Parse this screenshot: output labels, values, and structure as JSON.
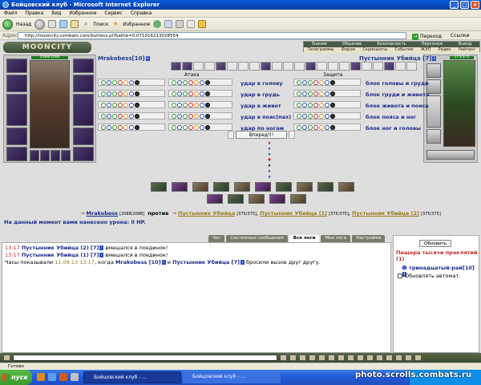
{
  "window": {
    "title": "Бойцовский клуб - Microsoft Internet Explorer"
  },
  "menu": [
    "Файл",
    "Правка",
    "Вид",
    "Избранное",
    "Сервис",
    "Справка"
  ],
  "toolbar": {
    "back": "Назад",
    "search": "Поиск",
    "favorites": "Избранное"
  },
  "address": {
    "label": "Адрес:",
    "url": "http://mooncity.combats.com/buttons.pl?battle=0.071016213028554",
    "go": "Переход",
    "links": "Ссылки"
  },
  "site": {
    "logo": "MOONCITY",
    "nav_row1": [
      "Знания",
      "Общение",
      "Безопасность",
      "Персонаж",
      "Выход"
    ],
    "nav_row2": [
      "Телеграммы",
      "Форум",
      "Скриншоты",
      "События",
      "ЖЭП",
      "Радио",
      "Рейтинг"
    ]
  },
  "player": {
    "name": "Mrakobess",
    "level": "[10]",
    "hp": "2088/2088"
  },
  "enemy": {
    "name": "Пустынник Убийца",
    "level": "[7]",
    "hp": "375/375"
  },
  "attack_label": "Атака",
  "defense_label": "Защита",
  "strikes": [
    "удар в голову",
    "удар в грудь",
    "удар в живот",
    "удар в пояс(пах)",
    "удар по ногам"
  ],
  "blocks": [
    "блок головы и груди",
    "блок груди и живота",
    "блок живота и пояса",
    "блок пояса и ног",
    "блок ног и головы"
  ],
  "forward_button": "Вперед!!!",
  "battle_line": {
    "player": "Mrakobess",
    "player_hp": "[2088/2088]",
    "versus": "против",
    "enemies": [
      {
        "name": "Пустынник Убийца",
        "hp": "[375/375]"
      },
      {
        "name": "Пустынник Убийца (1)",
        "hp": "[375/375]"
      },
      {
        "name": "Пустынник Убийца (2)",
        "hp": "[375/375]"
      }
    ]
  },
  "damage_text": "На данный момент вами нанесено урона: 0 HP.",
  "chat_tabs": [
    "Чат",
    "Системные сообщения",
    "Все логи",
    "Мои логи",
    "Настройки"
  ],
  "chat_active": 2,
  "chat_lines": [
    {
      "time": "13:17",
      "name": "Пустынник Убийца (2)",
      "lvl": "[7]",
      "text": " вмешался в поединок!"
    },
    {
      "time": "13:17",
      "name": "Пустынник Убийца (1)",
      "lvl": "[7]",
      "text": " вмешался в поединок!"
    }
  ],
  "chat_last": {
    "prefix": "Часы показывали ",
    "datetime": "11.09.13 13:17",
    "mid": ", когда ",
    "p1": "Mrakobess [10]",
    "and": " и ",
    "p2": "Пустынник Убийца [7]",
    "suffix": " бросили вызов друг другу."
  },
  "side": {
    "refresh": "Обновить",
    "location": "Пещера тысячи проклятий (1)",
    "user": "тринадцатый-рай[10]",
    "auto": "Обновлять автомат."
  },
  "status": "Готово",
  "taskbar": {
    "start": "пуск",
    "task1": "Бойцовский клуб - ...",
    "task2": "Бойцовский клуб - ..."
  },
  "watermark": "photo.scrolls.combats.ru"
}
